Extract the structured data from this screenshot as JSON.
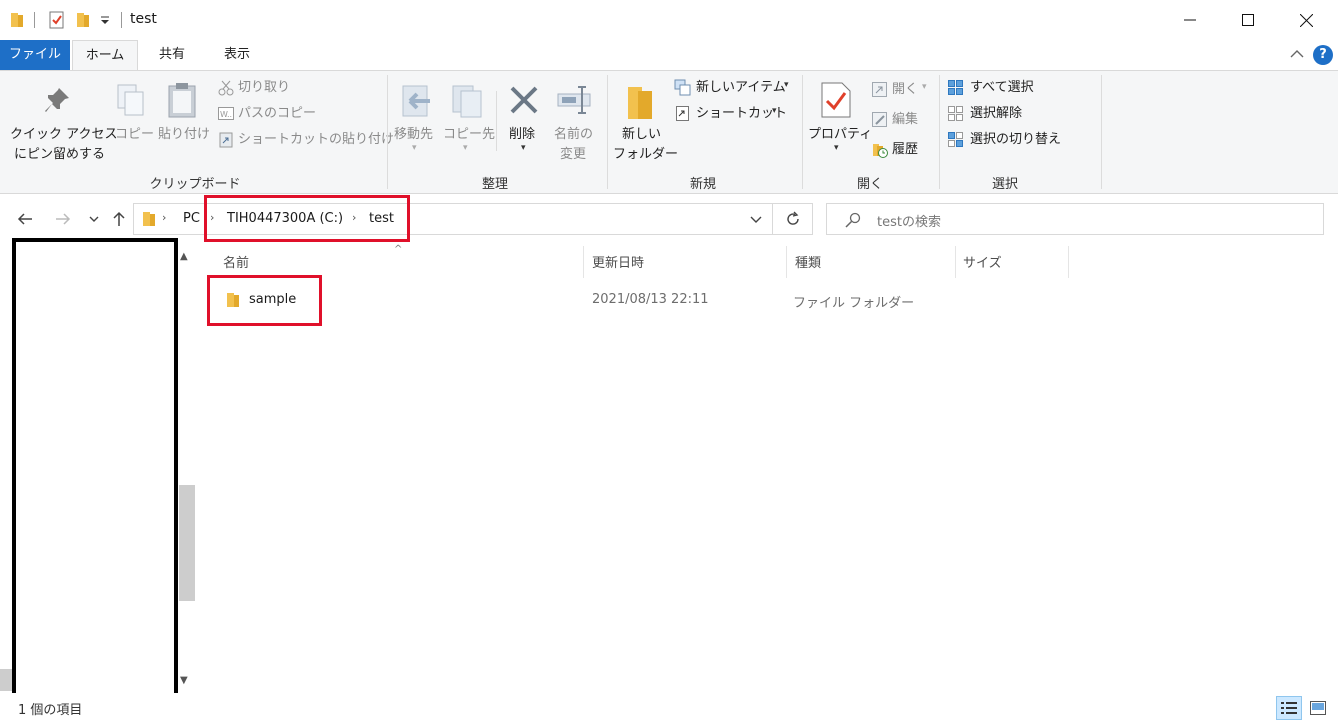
{
  "window": {
    "title": "test",
    "minimize_glyph": "—",
    "maximize_glyph": "☐",
    "close_glyph": "✕"
  },
  "tabs": [
    {
      "label": "ファイル",
      "active": false
    },
    {
      "label": "ホーム",
      "active": true
    },
    {
      "label": "共有",
      "active": false
    },
    {
      "label": "表示",
      "active": false
    }
  ],
  "ribbon": {
    "clipboard": {
      "label": "クリップボード",
      "pin_line1": "クイック アクセス",
      "pin_line2": "にピン留めする",
      "copy": "コピー",
      "paste": "貼り付け",
      "cut": "切り取り",
      "copy_path": "パスのコピー",
      "paste_shortcut": "ショートカットの貼り付け"
    },
    "organize": {
      "label": "整理",
      "move_to": "移動先",
      "copy_to": "コピー先",
      "delete": "削除",
      "rename_line1": "名前の",
      "rename_line2": "変更"
    },
    "new": {
      "label": "新規",
      "new_folder_line1": "新しい",
      "new_folder_line2": "フォルダー",
      "new_item": "新しいアイテム",
      "shortcut": "ショートカット"
    },
    "open": {
      "label": "開く",
      "properties": "プロパティ",
      "open": "開く",
      "edit": "編集",
      "history": "履歴"
    },
    "select": {
      "label": "選択",
      "select_all": "すべて選択",
      "select_none": "選択解除",
      "invert": "選択の切り替え"
    }
  },
  "address": {
    "crumbs": [
      "PC",
      "TIH0447300A (C:)",
      "test"
    ]
  },
  "search": {
    "placeholder": "testの検索"
  },
  "columns": [
    "名前",
    "更新日時",
    "種類",
    "サイズ"
  ],
  "rows": [
    {
      "name": "sample",
      "modified": "2021/08/13 22:11",
      "type": "ファイル フォルダー",
      "size": ""
    }
  ],
  "status": {
    "count": "1 個の項目"
  },
  "colors": {
    "accent": "#1e6fc7",
    "highlight_box": "#e0102a",
    "folder": "#f2c14e"
  }
}
